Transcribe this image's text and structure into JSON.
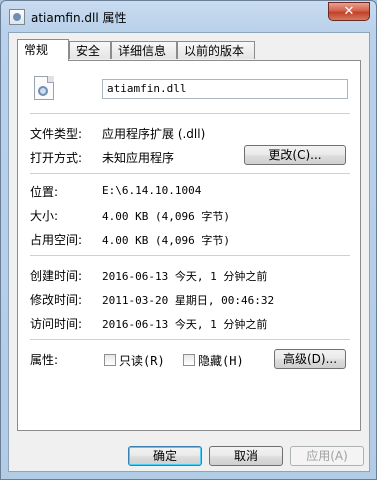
{
  "window": {
    "title": "atiamfin.dll 属性",
    "close_symbol": "✕"
  },
  "tabs": [
    {
      "label": "常规",
      "active": true
    },
    {
      "label": "安全",
      "active": false
    },
    {
      "label": "详细信息",
      "active": false
    },
    {
      "label": "以前的版本",
      "active": false
    }
  ],
  "general": {
    "file_name": "atiamfin.dll",
    "type": {
      "label": "文件类型:",
      "value": "应用程序扩展 (.dll)"
    },
    "opens_with": {
      "label": "打开方式:",
      "value": "未知应用程序",
      "change_button": "更改(C)..."
    },
    "location": {
      "label": "位置:",
      "value": "E:\\6.14.10.1004"
    },
    "size": {
      "label": "大小:",
      "value": "4.00 KB (4,096 字节)"
    },
    "size_on_disk": {
      "label": "占用空间:",
      "value": "4.00 KB (4,096 字节)"
    },
    "created": {
      "label": "创建时间:",
      "value": "2016-06-13 今天, 1 分钟之前"
    },
    "modified": {
      "label": "修改时间:",
      "value": "2011-03-20 星期日, 00:46:32"
    },
    "accessed": {
      "label": "访问时间:",
      "value": "2016-06-13 今天, 1 分钟之前"
    },
    "attributes": {
      "label": "属性:",
      "readonly": {
        "label": "只读(R)",
        "checked": false
      },
      "hidden": {
        "label": "隐藏(H)",
        "checked": false
      },
      "advanced_button": "高级(D)..."
    }
  },
  "footer": {
    "ok": "确定",
    "cancel": "取消",
    "apply": "应用(A)"
  },
  "colors": {
    "titlebar": "#b9d1ea",
    "close_button": "#c0412a",
    "default_button_border": "#3c7fb1"
  }
}
